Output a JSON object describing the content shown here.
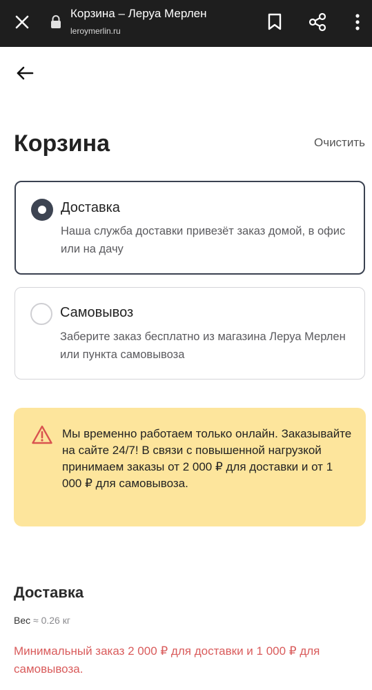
{
  "browser": {
    "title": "Корзина – Леруа Мерлен",
    "url": "leroymerlin.ru"
  },
  "page": {
    "title": "Корзина",
    "clear_label": "Очистить"
  },
  "delivery_options": [
    {
      "title": "Доставка",
      "description": "Наша служба доставки привезёт заказ домой, в офис или на дачу",
      "selected": true
    },
    {
      "title": "Самовывоз",
      "description": "Заберите заказ бесплатно из магазина Леруа Мерлен или пункта самовывоза",
      "selected": false
    }
  ],
  "notice": {
    "text": "Мы временно работаем только онлайн. Заказывайте на сайте 24/7! В связи с повышенной нагрузкой принимаем заказы от 2 000 ₽ для доставки и от 1 000 ₽ для самовывоза.",
    "color": "#fde59c"
  },
  "delivery_section": {
    "title": "Доставка",
    "weight_label": "Вес",
    "weight_value": "≈ 0.26 кг",
    "min_order_text": "Минимальный заказ 2 000 ₽ для доставки и 1 000 ₽ для самовывоза.",
    "min_order_color": "#d95b5b"
  },
  "icons": {
    "close": "close-icon",
    "lock": "lock-icon",
    "bookmark": "bookmark-icon",
    "share": "share-icon",
    "menu": "more-vert-icon",
    "back": "arrow-left-icon",
    "warning": "warning-icon"
  }
}
